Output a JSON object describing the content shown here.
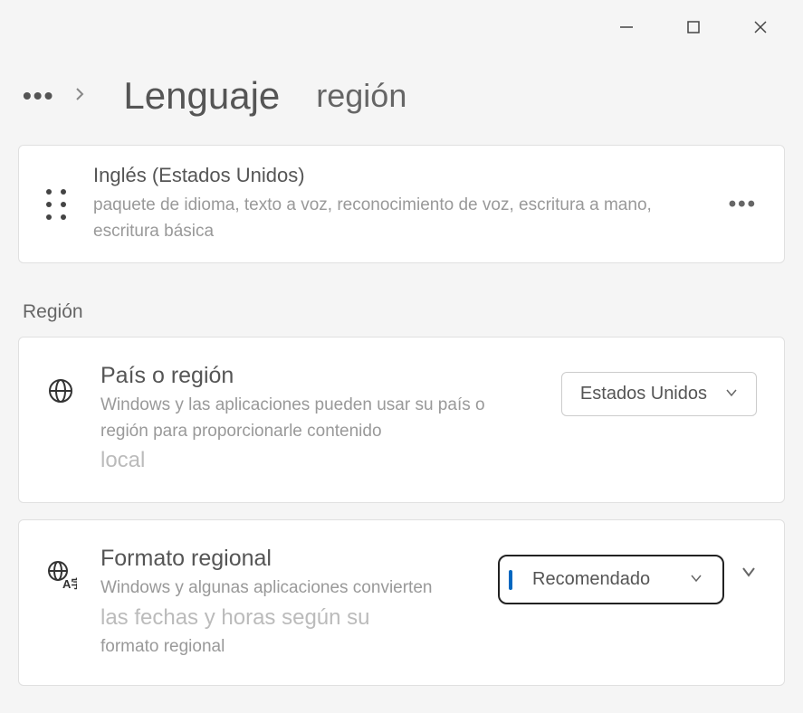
{
  "window": {
    "minimize": "—",
    "maximize": "▢",
    "close": "✕"
  },
  "breadcrumb": {
    "title": "Lenguaje",
    "sub": "región"
  },
  "language_card": {
    "title": "Inglés (Estados Unidos)",
    "description": "paquete de idioma, texto a voz, reconocimiento de voz, escritura a mano, escritura básica"
  },
  "section_label": "Región",
  "country_card": {
    "title": "País o región",
    "description": "Windows y las aplicaciones pueden usar su país o región para proporcionarle contenido",
    "description_local": "local",
    "dropdown": "Estados Unidos"
  },
  "format_card": {
    "title": "Formato regional",
    "description1": "Windows y algunas aplicaciones convierten",
    "description2": "las fechas y horas según su",
    "description3": "formato regional",
    "dropdown": "Recomendado"
  }
}
